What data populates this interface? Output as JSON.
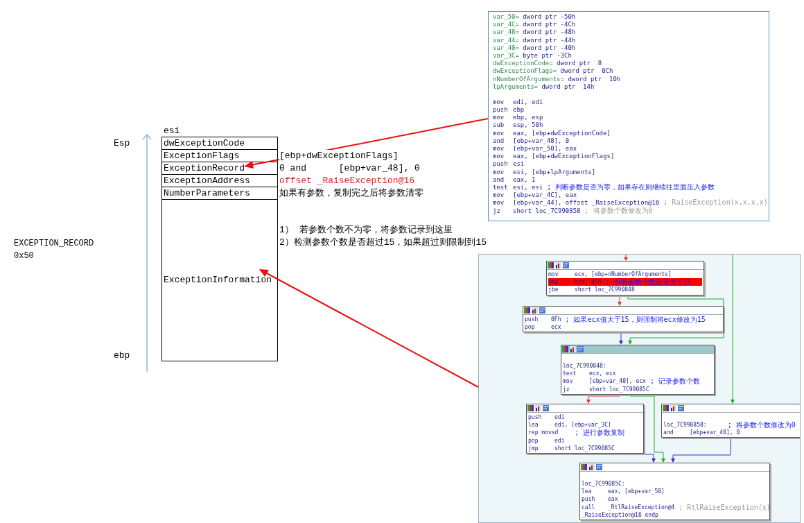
{
  "stack_diagram": {
    "top_label": "esi",
    "esp_label": "Esp",
    "ebp_label": "ebp",
    "record_name": "EXCEPTION_RECORD",
    "record_size": "0x50",
    "fields": [
      {
        "name": "dwExceptionCode"
      },
      {
        "name": "ExceptionFlags",
        "note": "[ebp+dwExceptionFlags]",
        "red": false
      },
      {
        "name": "ExceptionRecord",
        "note": "0 and      [ebp+var_48], 0",
        "red": false
      },
      {
        "name": "ExceptionAddress",
        "note": "offset _RaiseException@16",
        "red": true
      },
      {
        "name": "NumberParameters",
        "note": "如果有参数，复制完之后将参数清零",
        "red": false
      }
    ],
    "info_field": "ExceptionInformation",
    "info_notes": [
      "1） 若参数个数不为零，将参数记录到这里",
      "2）检测参数个数是否超过15，如果超过则限制到15"
    ]
  },
  "listing": {
    "lines": [
      {
        "kind": "decl",
        "name": "var_50=",
        "rest": "dword ptr -50h"
      },
      {
        "kind": "decl",
        "name": "var_4C=",
        "rest": "dword ptr -4Ch"
      },
      {
        "kind": "decl",
        "name": "var_48=",
        "rest": "dword ptr -48h"
      },
      {
        "kind": "decl",
        "name": "var_44=",
        "rest": "dword ptr -44h"
      },
      {
        "kind": "decl",
        "name": "var_40=",
        "rest": "dword ptr -40h"
      },
      {
        "kind": "decl",
        "name": "var_3C=",
        "rest": "byte ptr -3Ch"
      },
      {
        "kind": "decl",
        "name": "dwExceptionCode=",
        "rest": "dword ptr  8"
      },
      {
        "kind": "decl",
        "name": "dwExceptionFlags=",
        "rest": "dword ptr  0Ch"
      },
      {
        "kind": "decl",
        "name": "nNumberOfArguments=",
        "rest": "dword ptr  10h"
      },
      {
        "kind": "decl",
        "name": "lpArguments=",
        "rest": "dword ptr  14h"
      },
      {
        "kind": "blank"
      },
      {
        "kind": "code",
        "op": "mov",
        "args": "edi, edi"
      },
      {
        "kind": "code",
        "op": "push",
        "args": "ebp"
      },
      {
        "kind": "code",
        "op": "mov",
        "args": "ebp, esp"
      },
      {
        "kind": "code",
        "op": "sub",
        "args": "esp, 50h"
      },
      {
        "kind": "code",
        "op": "mov",
        "args": "eax, [ebp+dwExceptionCode]"
      },
      {
        "kind": "code",
        "op": "and",
        "args": "[ebp+var_48], 0"
      },
      {
        "kind": "code",
        "op": "mov",
        "args": "[ebp+var_50], eax"
      },
      {
        "kind": "code",
        "op": "mov",
        "args": "eax, [ebp+dwExceptionFlags]"
      },
      {
        "kind": "code",
        "op": "push",
        "args": "esi"
      },
      {
        "kind": "code",
        "op": "mov",
        "args": "esi, [ebp+lpArguments]"
      },
      {
        "kind": "code",
        "op": "and",
        "args": "eax, 1"
      },
      {
        "kind": "code",
        "op": "test",
        "args": "esi, esi",
        "comment": "; 判断参数是否为零，如果存在则继续往里面压入参数",
        "muted": false
      },
      {
        "kind": "code",
        "op": "mov",
        "args": "[ebp+var_4C], eax"
      },
      {
        "kind": "code",
        "op": "mov",
        "args": "[ebp+var_44], offset _RaiseException@16",
        "comment": "; RaiseException(x,x,x,x)",
        "muted": true
      },
      {
        "kind": "code",
        "op": "jz",
        "args": "short loc_7C990858",
        "comment": "; 将参数个数修改为0",
        "muted": true
      }
    ]
  },
  "graph": {
    "nodes": [
      {
        "selected": false,
        "lines": [
          {
            "kind": "code",
            "op": "mov",
            "args": "ecx, [ebp+nNumberOfArguments]"
          },
          {
            "kind": "code",
            "op": "cmp",
            "args": "ecx, 0Fh",
            "comment": "; 判断参数个数是否大于15",
            "muted": false,
            "highlight": true
          },
          {
            "kind": "code",
            "op": "jbe",
            "args": "short loc_7C990848"
          }
        ]
      },
      {
        "selected": false,
        "lines": [
          {
            "kind": "code",
            "op": "push",
            "args": "0Fh",
            "comment": "; 如果ecx值大于15，则强制将ecx修改为15",
            "muted": false
          },
          {
            "kind": "code",
            "op": "pop",
            "args": "ecx"
          }
        ]
      },
      {
        "selected": true,
        "lines": [
          {
            "kind": "blank"
          },
          {
            "kind": "label",
            "text": "loc_7C990848:"
          },
          {
            "kind": "code",
            "op": "test",
            "args": "ecx, ecx"
          },
          {
            "kind": "code",
            "op": "mov",
            "args": "[ebp+var_40], ecx",
            "comment": "; 记录参数个数",
            "muted": false
          },
          {
            "kind": "code",
            "op": "jz",
            "args": "short loc_7C99085C"
          }
        ]
      },
      {
        "selected": false,
        "lines": [
          {
            "kind": "code",
            "op": "push",
            "args": "edi"
          },
          {
            "kind": "code",
            "op": "lea",
            "args": "edi, [ebp+var_3C]"
          },
          {
            "kind": "code",
            "op": "rep movsd",
            "comment": "; 进行参数复制",
            "muted": false
          },
          {
            "kind": "code",
            "op": "pop",
            "args": "edi"
          },
          {
            "kind": "code",
            "op": "jmp",
            "args": "short loc_7C99085C"
          }
        ]
      },
      {
        "selected": false,
        "lines": [
          {
            "kind": "blank"
          },
          {
            "kind": "label",
            "text": "loc_7C990858:",
            "comment": "; 将参数个数修改为0",
            "muted": false
          },
          {
            "kind": "code",
            "op": "and",
            "args": "[ebp+var_40], 0"
          }
        ]
      },
      {
        "selected": false,
        "lines": [
          {
            "kind": "blank"
          },
          {
            "kind": "label",
            "text": "loc_7C99085C:"
          },
          {
            "kind": "code",
            "op": "lea",
            "args": "eax, [ebp+var_50]"
          },
          {
            "kind": "code",
            "op": "push",
            "args": "eax"
          },
          {
            "kind": "code",
            "op": "call",
            "args": "_RtlRaiseException@4",
            "comment": "; RtlRaiseException(x)",
            "muted": true
          },
          {
            "kind": "label",
            "text": "_RaiseException@16 endp"
          }
        ]
      }
    ]
  }
}
